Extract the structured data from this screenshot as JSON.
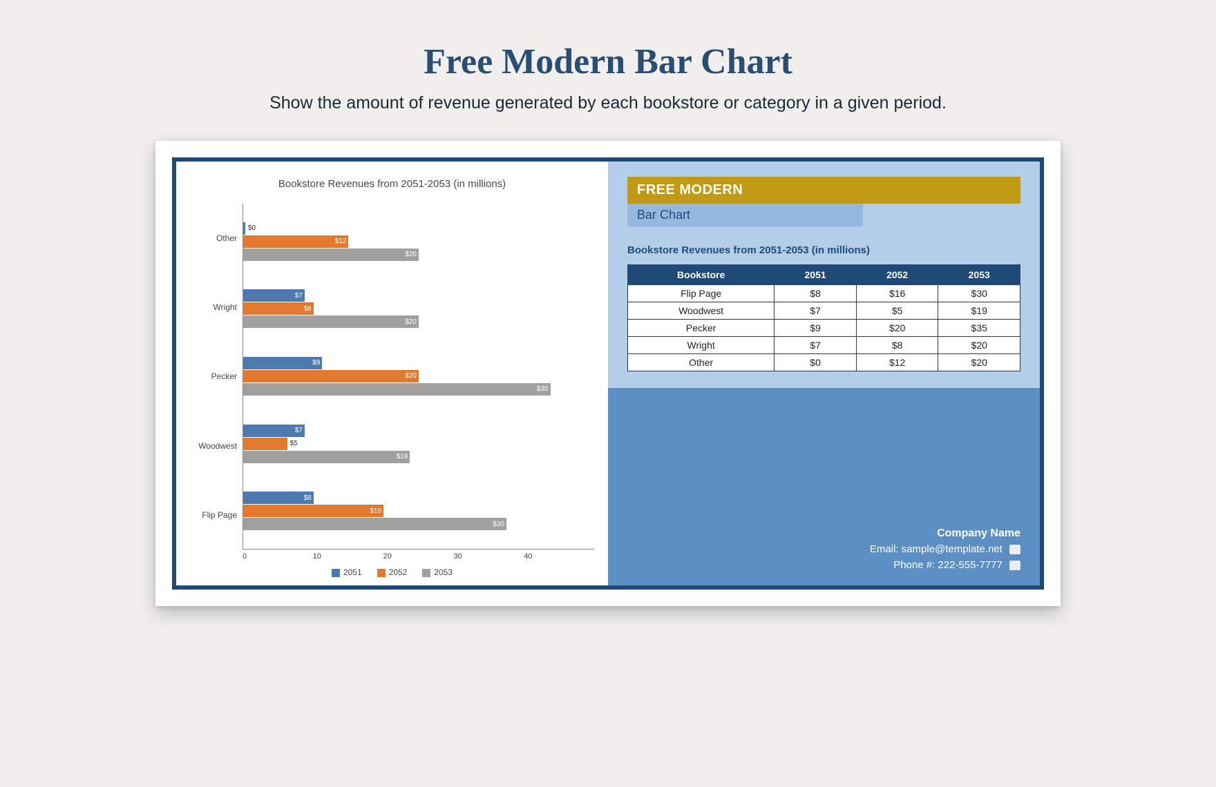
{
  "page": {
    "title": "Free Modern Bar Chart",
    "subtitle": "Show the amount of revenue generated by each bookstore or category in a given period."
  },
  "chart_data": {
    "type": "bar",
    "orientation": "horizontal",
    "title": "Bookstore Revenues from 2051-2053 (in millions)",
    "categories": [
      "Other",
      "Wright",
      "Pecker",
      "Woodwest",
      "Flip Page"
    ],
    "series": [
      {
        "name": "2051",
        "values": [
          0,
          7,
          9,
          7,
          8
        ],
        "labels": [
          "$0",
          "$7",
          "$9",
          "$7",
          "$8"
        ],
        "color": "#4b79b0"
      },
      {
        "name": "2052",
        "values": [
          12,
          8,
          20,
          5,
          16
        ],
        "labels": [
          "$12",
          "$8",
          "$20",
          "$5",
          "$16"
        ],
        "color": "#e17a2e"
      },
      {
        "name": "2053",
        "values": [
          20,
          20,
          35,
          19,
          30
        ],
        "labels": [
          "$20",
          "$20",
          "$35",
          "$19",
          "$30"
        ],
        "color": "#a0a0a0"
      }
    ],
    "xticks": [
      "0",
      "10",
      "20",
      "30",
      "40"
    ],
    "xlim": [
      0,
      40
    ],
    "xlabel": "",
    "ylabel": ""
  },
  "right": {
    "banner_line1": "FREE MODERN",
    "banner_line2": "Bar Chart",
    "table_title": "Bookstore Revenues from 2051-2053 (in millions)",
    "columns": [
      "Bookstore",
      "2051",
      "2052",
      "2053"
    ],
    "rows": [
      {
        "name": "Flip Page",
        "c2051": "$8",
        "c2052": "$16",
        "c2053": "$30"
      },
      {
        "name": "Woodwest",
        "c2051": "$7",
        "c2052": "$5",
        "c2053": "$19"
      },
      {
        "name": "Pecker",
        "c2051": "$9",
        "c2052": "$20",
        "c2053": "$35"
      },
      {
        "name": "Wright",
        "c2051": "$7",
        "c2052": "$8",
        "c2053": "$20"
      },
      {
        "name": "Other",
        "c2051": "$0",
        "c2052": "$12",
        "c2053": "$20"
      }
    ]
  },
  "contact": {
    "company": "Company Name",
    "email_label": "Email: sample@template.net",
    "phone_label": "Phone #: 222-555-7777"
  }
}
